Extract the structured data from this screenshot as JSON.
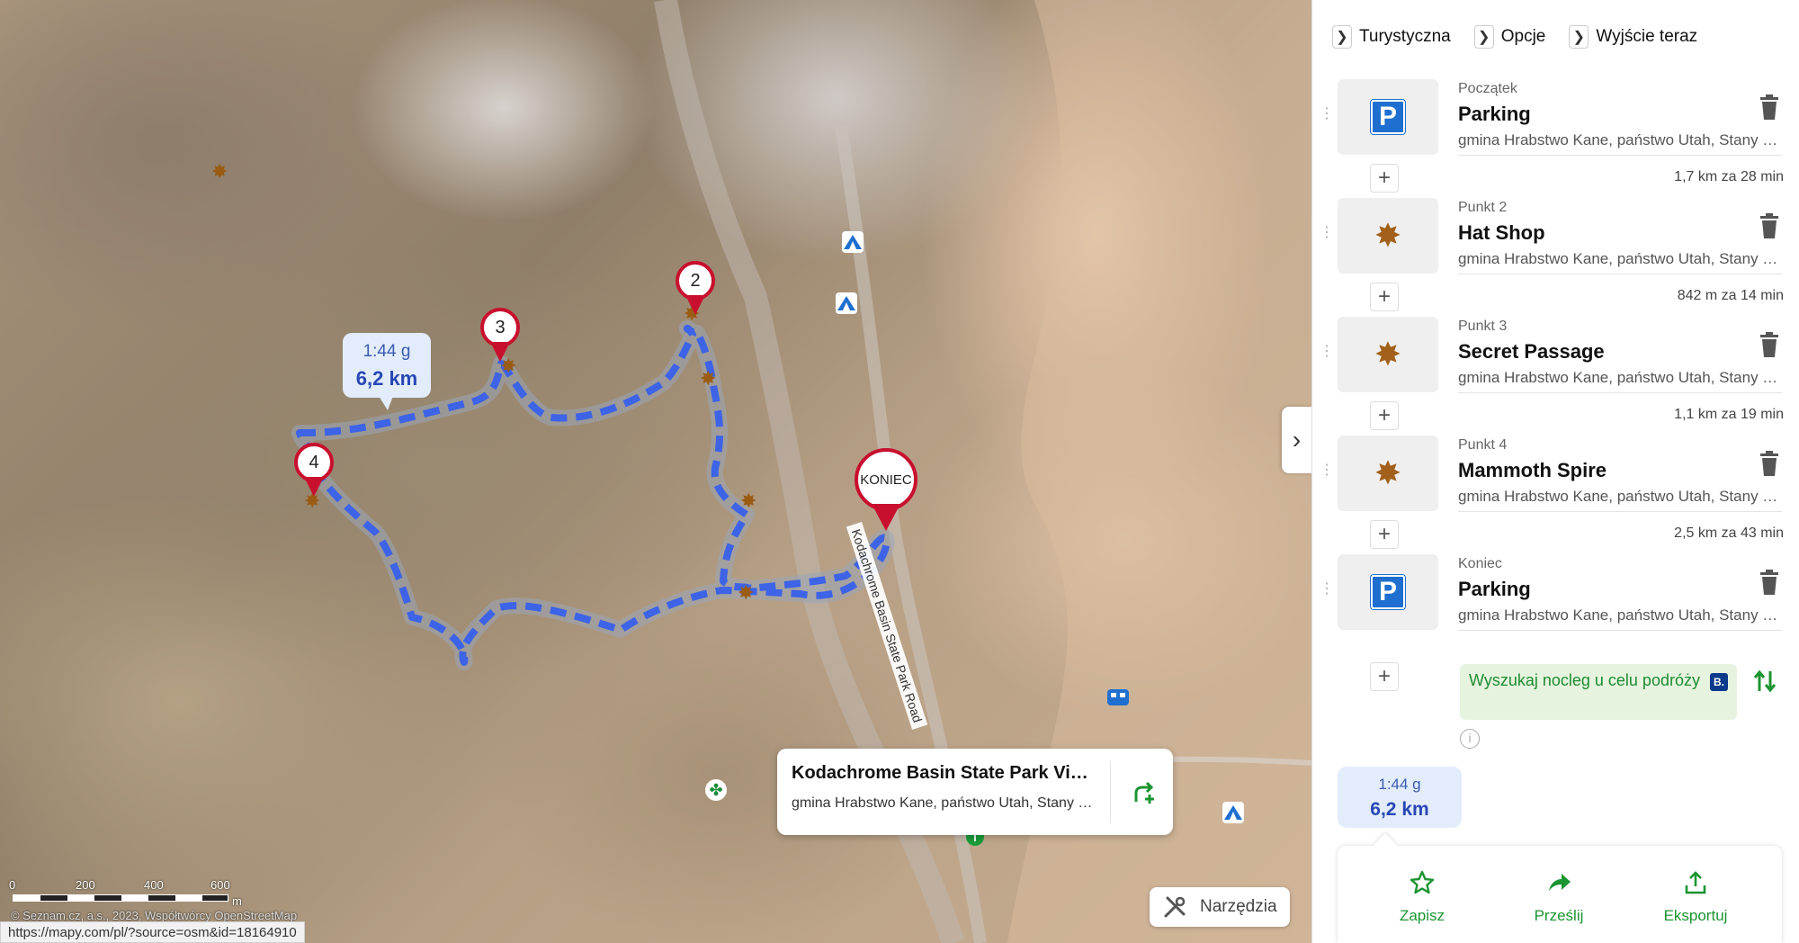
{
  "map": {
    "route_summary": {
      "time": "1:44 g",
      "distance": "6,2 km"
    },
    "markers": [
      "2",
      "3",
      "4",
      "KONIEC"
    ],
    "road_label": "Kodachrome Basin State Park Road",
    "popup": {
      "title": "Kodachrome Basin State Park Visitor Center",
      "subtitle": "gmina Hrabstwo Kane, państwo Utah, Stany Zjednoczone"
    },
    "scale": {
      "labels": [
        "0",
        "200",
        "400",
        "600"
      ],
      "unit": "m"
    },
    "attribution": "© Seznam.cz, a.s., 2023, Współtwórcy OpenStreetMap",
    "status_url": "https://mapy.com/pl/?source=osm&id=18164910",
    "tools_label": "Narzędzia",
    "collapse_icon": "›"
  },
  "panel": {
    "options": [
      {
        "label": "Turystyczna"
      },
      {
        "label": "Opcje"
      },
      {
        "label": "Wyjście teraz"
      }
    ],
    "waypoints": [
      {
        "role": "Początek",
        "name": "Parking",
        "address": "gmina Hrabstwo Kane, państwo Utah, Stany Zjednoczone",
        "icon": "parking-icon"
      },
      {
        "role": "Punkt 2",
        "name": "Hat Shop",
        "address": "gmina Hrabstwo Kane, państwo Utah, Stany Zjednoczone",
        "icon": "poi-star-icon"
      },
      {
        "role": "Punkt 3",
        "name": "Secret Passage",
        "address": "gmina Hrabstwo Kane, państwo Utah, Stany Zjednoczone",
        "icon": "poi-star-icon"
      },
      {
        "role": "Punkt 4",
        "name": "Mammoth Spire",
        "address": "gmina Hrabstwo Kane, państwo Utah, Stany Zjednoczone",
        "icon": "poi-star-icon"
      },
      {
        "role": "Koniec",
        "name": "Parking",
        "address": "gmina Hrabstwo Kane, państwo Utah, Stany Zjednoczone",
        "icon": "parking-icon"
      }
    ],
    "segments": [
      {
        "distance": "1,7 km za 28 min"
      },
      {
        "distance": "842 m za 14 min"
      },
      {
        "distance": "1,1 km za 19 min"
      },
      {
        "distance": "2,5 km za 43 min"
      }
    ],
    "booking": {
      "text": "Wyszukaj nocleg u celu podróży",
      "badge": "B."
    },
    "summary": {
      "time": "1:44 g",
      "distance": "6,2 km"
    },
    "actions": [
      {
        "label": "Zapisz",
        "icon": "star-icon"
      },
      {
        "label": "Prześlij",
        "icon": "share-icon"
      },
      {
        "label": "Eksportuj",
        "icon": "export-icon"
      }
    ]
  },
  "colors": {
    "route": "#3d63e6",
    "accent_green": "#1c9431",
    "pin_red": "#c8102e",
    "parking_blue": "#1e6fd0"
  }
}
